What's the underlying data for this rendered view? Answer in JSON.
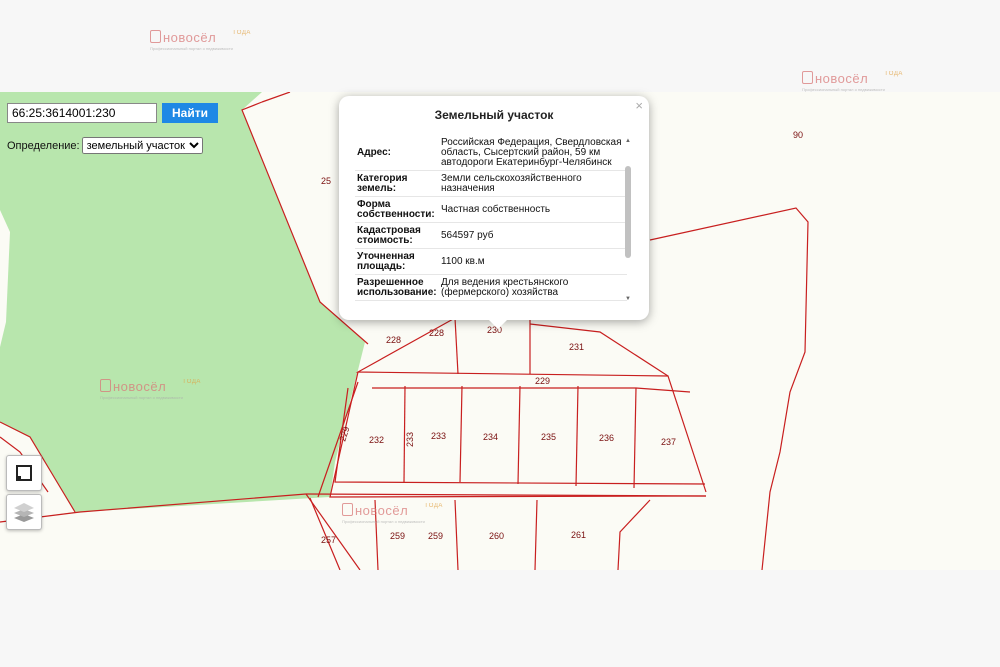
{
  "search": {
    "value": "66:25:3614001:230",
    "button_label": "Найти"
  },
  "definition": {
    "label": "Определение:",
    "selected": "земельный участок"
  },
  "popup": {
    "title": "Земельный участок",
    "close": "×",
    "rows": [
      {
        "key": "Адрес:",
        "value": "Российская Федерация, Свердловская область, Сысертский район, 59 км автодороги Екатеринбург-Челябинск"
      },
      {
        "key": "Категория земель:",
        "value": "Земли сельскохозяйственного назначения"
      },
      {
        "key": "Форма собственности:",
        "value": "Частная собственность"
      },
      {
        "key": "Кадастровая стоимость:",
        "value": "564597 руб"
      },
      {
        "key": "Уточненная площадь:",
        "value": "1100 кв.м"
      },
      {
        "key": "Разрешенное использование:",
        "value": "Для ведения крестьянского (фермерского) хозяйства"
      }
    ]
  },
  "plots": {
    "p25": "25",
    "p90": "90",
    "p228a": "228",
    "p228b": "228",
    "p230": "230",
    "p231": "231",
    "p229a": "229",
    "p229b": "229",
    "p232": "232",
    "p233a": "233",
    "p233b": "233",
    "p234": "234",
    "p235": "235",
    "p236": "236",
    "p237": "237",
    "p257": "257",
    "p259a": "259",
    "p259b": "259",
    "p260": "260",
    "p261": "261"
  },
  "watermark": {
    "brand": "новосёл",
    "sub": "Профессиональный портал о недвижимости",
    "year": "ГОДА"
  },
  "colors": {
    "forest": "#b8e6ad",
    "boundary": "#c81f1f",
    "button": "#1e88e5"
  },
  "icons": {
    "draw_tool": "square-select-icon",
    "layers_tool": "layers-icon"
  }
}
